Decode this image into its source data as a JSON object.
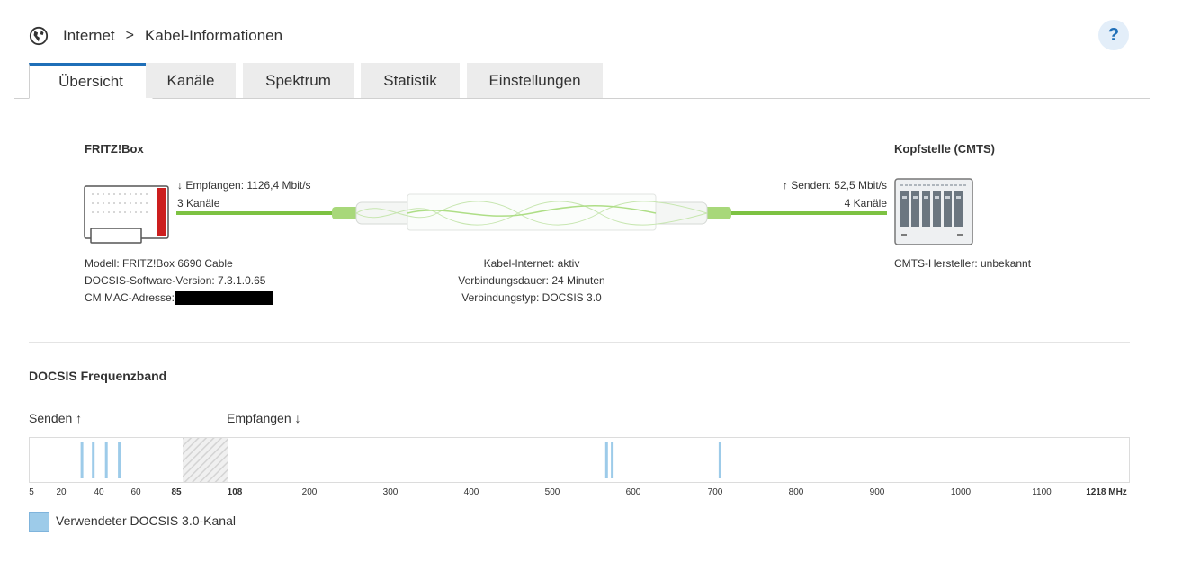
{
  "breadcrumb": {
    "section": "Internet",
    "separator": ">",
    "page": "Kabel-Informationen"
  },
  "help": {
    "label": "?"
  },
  "tabs": [
    {
      "label": "Übersicht",
      "active": true
    },
    {
      "label": "Kanäle",
      "active": false
    },
    {
      "label": "Spektrum",
      "active": false
    },
    {
      "label": "Statistik",
      "active": false
    },
    {
      "label": "Einstellungen",
      "active": false
    }
  ],
  "overview": {
    "left_title": "FRITZ!Box",
    "right_title": "Kopfstelle (CMTS)",
    "downstream": "↓ Empfangen: 1126,4 Mbit/s",
    "downstream_channels": "3 Kanäle",
    "upstream": "↑ Senden: 52,5 Mbit/s",
    "upstream_channels": "4 Kanäle",
    "model": "Modell: FRITZ!Box 6690 Cable",
    "docsis_version": "DOCSIS-Software-Version: 7.3.1.0.65",
    "cm_mac_label": "CM MAC-Adresse:",
    "status": "Kabel-Internet: aktiv",
    "duration": "Verbindungsdauer: 24 Minuten",
    "type": "Verbindungstyp: DOCSIS 3.0",
    "cmts_vendor": "CMTS-Hersteller: unbekannt"
  },
  "band": {
    "title": "DOCSIS Frequenzband",
    "send_label": "Senden ↑",
    "receive_label": "Empfangen ↓",
    "ticks": [
      "5",
      "20",
      "40",
      "60",
      "85",
      "108",
      "200",
      "300",
      "400",
      "500",
      "600",
      "700",
      "800",
      "900",
      "1000",
      "1100",
      "1218 MHz"
    ],
    "legend": "Verwendeter DOCSIS 3.0-Kanal",
    "channel_color": "#9dcbe9",
    "upstream_channels_mhz": [
      31,
      37,
      44,
      51
    ],
    "downstream_channels_mhz": [
      567,
      574,
      706
    ]
  },
  "colors": {
    "accent": "#1f6fb8",
    "link_green": "#7dc242",
    "device_red": "#cc1e1e"
  }
}
